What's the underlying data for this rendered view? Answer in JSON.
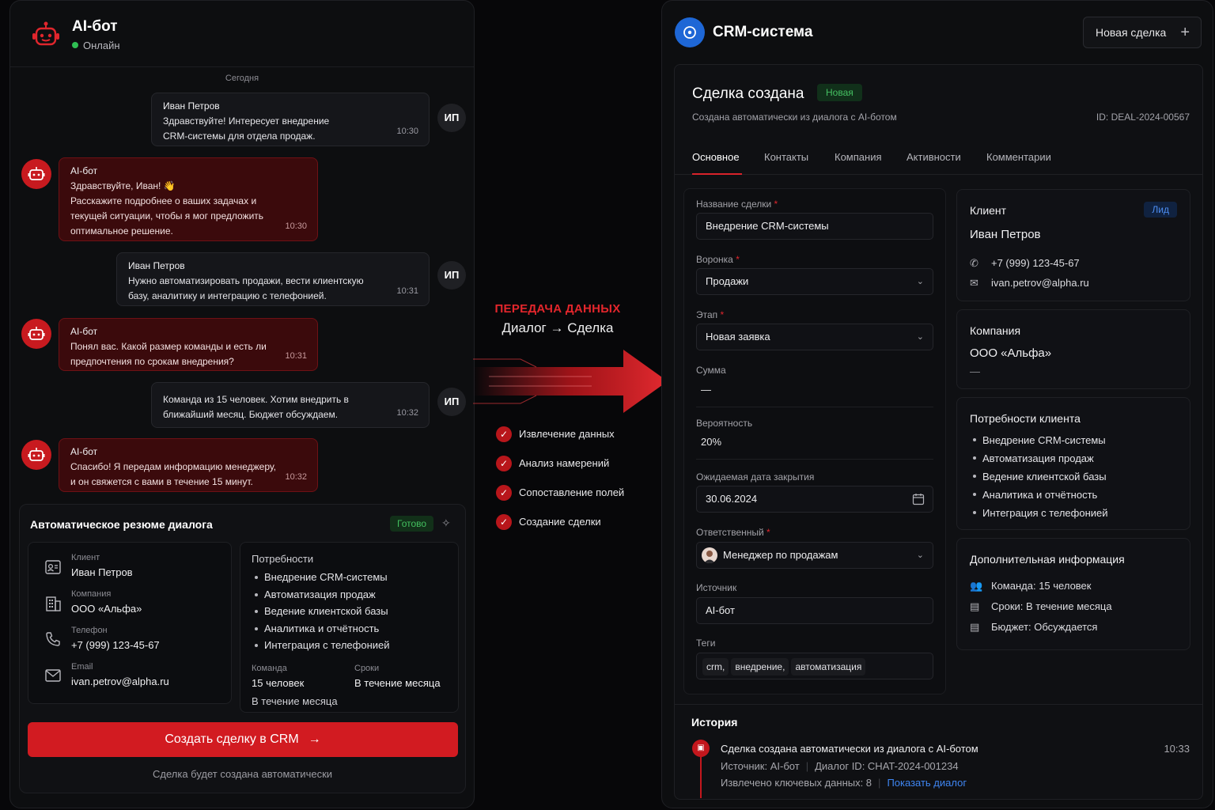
{
  "colors": {
    "accent_red": "#d21b21",
    "bot_bubble": "#3b0a0c",
    "crm_blue": "#1e67d6",
    "success_green": "#43c05f",
    "link_blue": "#3f86f2"
  },
  "chat": {
    "title": "AI-бот",
    "status": "Онлайн",
    "day_label": "Сегодня",
    "user_avatar": "ИП",
    "messages": [
      {
        "from": "user",
        "author": "Иван Петров",
        "lines": [
          "Здравствуйте! Интересует внедрение",
          "CRM-системы для отдела продаж."
        ],
        "time": "10:30"
      },
      {
        "from": "bot",
        "author": "AI-бот",
        "lines": [
          "Здравствуйте, Иван! 👋",
          "Расскажите подробнее о ваших задачах и",
          "текущей ситуации, чтобы я мог предложить",
          "оптимальное решение."
        ],
        "time": "10:30"
      },
      {
        "from": "user",
        "author": "Иван Петров",
        "lines": [
          "Нужно автоматизировать продажи, вести клиентскую",
          "базу, аналитику и интеграцию с телефонией."
        ],
        "time": "10:31"
      },
      {
        "from": "bot",
        "author": "AI-бот",
        "lines": [
          "Понял вас. Какой размер команды и есть ли",
          "предпочтения по срокам внедрения?"
        ],
        "time": "10:31"
      },
      {
        "from": "user",
        "author": "",
        "lines": [
          "Команда из 15 человек. Хотим внедрить в",
          "ближайший месяц. Бюджет обсуждаем."
        ],
        "time": "10:32"
      },
      {
        "from": "bot",
        "author": "AI-бот",
        "lines": [
          "Спасибо! Я передам информацию менеджеру,",
          "и он свяжется с вами в течение 15 минут."
        ],
        "time": "10:32"
      }
    ]
  },
  "summary": {
    "title": "Автоматическое резюме диалога",
    "status": "Готово",
    "client_label": "Клиент",
    "client": "Иван Петров",
    "company_label": "Компания",
    "company": "ООО «Альфа»",
    "phone_label": "Телефон",
    "phone": "+7 (999) 123-45-67",
    "email_label": "Email",
    "email": "ivan.petrov@alpha.ru",
    "needs_label": "Потребности",
    "needs": [
      "Внедрение CRM-системы",
      "Автоматизация продаж",
      "Ведение клиентской базы",
      "Аналитика и отчётность",
      "Интеграция с телефонией"
    ],
    "team_label": "Команда",
    "team": "15 человек",
    "terms_label": "Сроки",
    "terms": "В течение месяца",
    "extra": "В течение месяца",
    "create_button": "Создать сделку в CRM",
    "create_note": "Сделка будет создана автоматически"
  },
  "transfer": {
    "title": "ПЕРЕДАЧА ДАННЫХ",
    "subtitle": "Диалог → Сделка",
    "steps": [
      "Извлечение данных",
      "Анализ намерений",
      "Сопоставление полей",
      "Создание сделки"
    ]
  },
  "crm": {
    "title": "CRM-система",
    "new_deal_button": "Новая сделка",
    "deal_title": "Сделка создана",
    "deal_badge": "Новая",
    "deal_subtitle": "Создана автоматически из диалога с AI-ботом",
    "deal_id": "ID: DEAL-2024-00567",
    "tabs": [
      "Основное",
      "Контакты",
      "Компания",
      "Активности",
      "Комментарии"
    ],
    "form": {
      "name_label": "Название сделки",
      "name": "Внедрение CRM-системы",
      "funnel_label": "Воронка",
      "funnel": "Продажи",
      "stage_label": "Этап",
      "stage": "Новая заявка",
      "amount_label": "Сумма",
      "amount": "—",
      "prob_label": "Вероятность",
      "prob": "20%",
      "close_label": "Ожидаемая дата закрытия",
      "close": "30.06.2024",
      "owner_label": "Ответственный",
      "owner": "Менеджер по продажам",
      "source_label": "Источник",
      "source": "AI-бот",
      "tags_label": "Теги",
      "tags": [
        "crm,",
        "внедрение,",
        "автоматизация"
      ]
    },
    "client_card": {
      "title": "Клиент",
      "badge": "Лид",
      "name": "Иван Петров",
      "phone": "+7 (999) 123-45-67",
      "email": "ivan.petrov@alpha.ru"
    },
    "company_card": {
      "title": "Компания",
      "name": "ООО «Альфа»",
      "dash": "—"
    },
    "needs_card": {
      "title": "Потребности клиента",
      "items": [
        "Внедрение CRM-системы",
        "Автоматизация продаж",
        "Ведение клиентской базы",
        "Аналитика и отчётность",
        "Интеграция с телефонией"
      ]
    },
    "extra_card": {
      "title": "Дополнительная информация",
      "items": [
        "Команда: 15 человек",
        "Сроки: В течение месяца",
        "Бюджет: Обсуждается"
      ]
    },
    "history": {
      "title": "История",
      "event": "Сделка создана автоматически из диалога с AI-ботом",
      "time": "10:33",
      "source": "Источник: AI-бот",
      "dialog": "Диалог ID: CHAT-2024-001234",
      "extracted": "Извлечено ключевых данных: 8",
      "show_dialog": "Показать диалог"
    }
  }
}
